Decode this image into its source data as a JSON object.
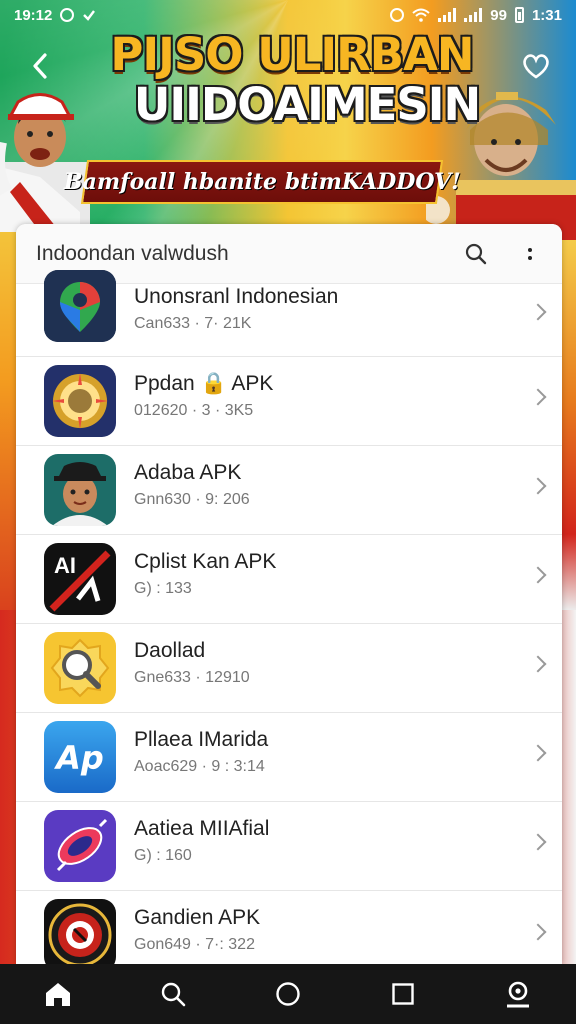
{
  "status_bar": {
    "time": "19:12",
    "battery_text": "99",
    "clock_right": "1:31"
  },
  "banner": {
    "title_line1": "PIJSO ULIRBAN",
    "title_line2": "UIIDOAIMESIN",
    "ribbon_text": "Bamfoall hbanite btimKADDOV!"
  },
  "header": {
    "title": "Indoondan valwdush",
    "search_icon": "search-icon",
    "more_icon": "more-vertical-icon",
    "back_icon": "back-chevron-icon",
    "heart_icon": "heart-icon"
  },
  "apps": [
    {
      "name": "Unonsranl Indonesian",
      "meta": "Can633 · 7· 21K",
      "icon": "maps-pin-icon"
    },
    {
      "name": "Ppdan 🔒 APK",
      "meta": "012620 · 3 · 3K5",
      "icon": "gold-compass-icon"
    },
    {
      "name": "Adaba APK",
      "meta": "Gnn630 · 9: 206",
      "icon": "boy-avatar-icon"
    },
    {
      "name": "Cplist Kan APK",
      "meta": "G) : 133",
      "icon": "ai-slash-icon"
    },
    {
      "name": "Daollad",
      "meta": "Gne633 · 12910",
      "icon": "magnifier-badge-icon"
    },
    {
      "name": "Pllaea IMarida",
      "meta": "Aoac629 · 9 : 3:14",
      "icon": "ap-logo-icon"
    },
    {
      "name": "Aatiea MIIAfial",
      "meta": "G) : 160",
      "icon": "rocket-card-icon"
    },
    {
      "name": "Gandien APK",
      "meta": "Gon649 · 7·: 322",
      "icon": "target-emblem-icon"
    }
  ],
  "bottom_nav": [
    "home-icon",
    "search-icon",
    "circle-home-icon",
    "square-recents-icon",
    "account-icon"
  ],
  "colors": {
    "accent_orange": "#f7b622",
    "ribbon_red": "#7a120c",
    "card_bg": "#ffffff",
    "nav_bg": "#161616"
  }
}
